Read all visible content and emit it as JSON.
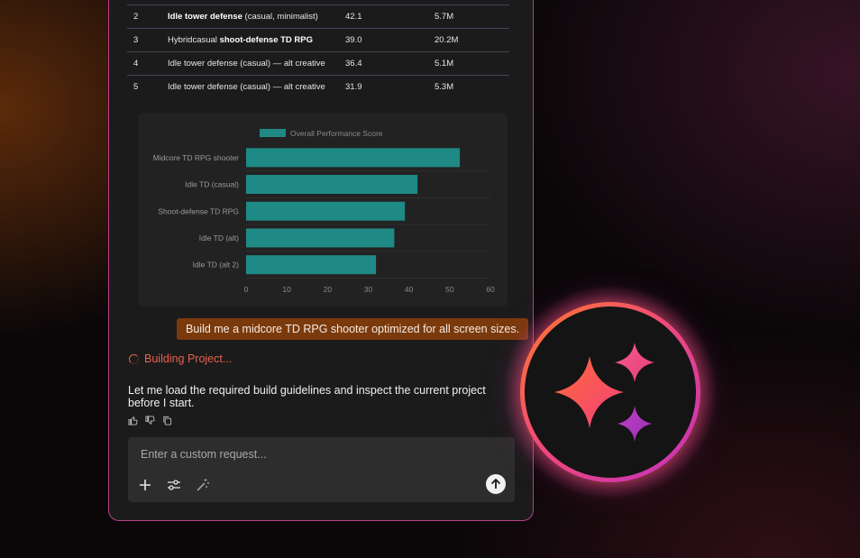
{
  "results_table": {
    "rows": [
      {
        "rank": "2",
        "name_prefix": "",
        "name_bold": "Idle tower defense",
        "name_suffix": " (casual, minimalist)",
        "score": "42.1",
        "volume": "5.7M"
      },
      {
        "rank": "3",
        "name_prefix": "Hybridcasual ",
        "name_bold": "shoot-defense TD RPG",
        "name_suffix": "",
        "score": "39.0",
        "volume": "20.2M"
      },
      {
        "rank": "4",
        "name_prefix": "Idle tower defense (casual) — alt creative",
        "name_bold": "",
        "name_suffix": "",
        "score": "36.4",
        "volume": "5.1M"
      },
      {
        "rank": "5",
        "name_prefix": "Idle tower defense (casual) — alt creative",
        "name_bold": "",
        "name_suffix": "",
        "score": "31.9",
        "volume": "5.3M"
      }
    ]
  },
  "chart_data": {
    "type": "bar",
    "orientation": "horizontal",
    "categories": [
      "Midcore TD RPG shooter",
      "Idle TD (casual)",
      "Shoot-defense TD RPG",
      "Idle TD (alt)",
      "Idle TD (alt 2)"
    ],
    "series": [
      {
        "name": "Overall Performance Score",
        "values": [
          52.5,
          42.1,
          39.0,
          36.4,
          31.9
        ],
        "color": "#1f8a85"
      }
    ],
    "xlim": [
      0,
      60
    ],
    "xticks": [
      0,
      10,
      20,
      30,
      40,
      50,
      60
    ],
    "grid": true,
    "legend": "top"
  },
  "chat": {
    "user_message": "Build me a midcore TD RPG shooter optimized for all screen sizes.",
    "status": "Building Project...",
    "assistant_message": "Let me load the required build guidelines and inspect the current project before I start."
  },
  "composer": {
    "placeholder": "Enter a custom request...",
    "icons": [
      "plus-icon",
      "sliders-icon",
      "magic-wand-icon",
      "send-arrow-icon"
    ]
  },
  "colors": {
    "accent_orange": "#ff7a2a",
    "accent_pink": "#f04a78",
    "accent_purple": "#c030c0",
    "bar": "#1f8a85",
    "user_bubble": "#7a3a0c",
    "status_text": "#e8604e"
  }
}
